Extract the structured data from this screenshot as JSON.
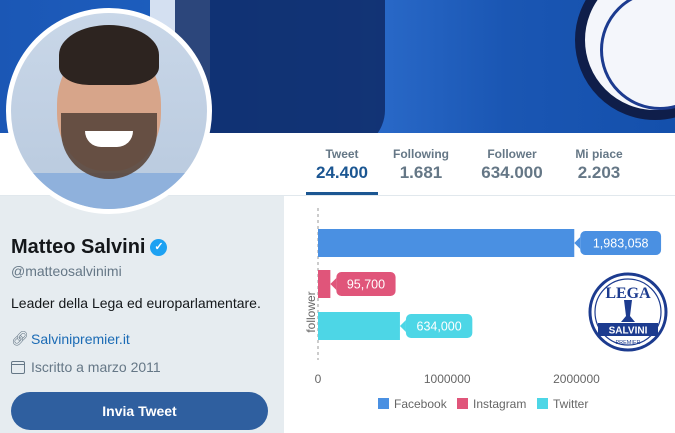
{
  "profile": {
    "name": "Matteo Salvini",
    "handle": "@matteosalvinimi",
    "bio": "Leader della Lega ed europarlamentare.",
    "link": "Salvinipremier.it",
    "joined": "Iscritto a marzo 2011",
    "tweet_button": "Invia Tweet"
  },
  "stats": [
    {
      "label": "Tweet",
      "value": "24.400",
      "active": true
    },
    {
      "label": "Following",
      "value": "1.681",
      "active": false
    },
    {
      "label": "Follower",
      "value": "634.000",
      "active": false
    },
    {
      "label": "Mi piace",
      "value": "2.203",
      "active": false
    }
  ],
  "logo": {
    "top": "LEGA",
    "bottom": "SALVINI",
    "sub": "PREMIER"
  },
  "colors": {
    "accent": "#1b5692",
    "facebook": "#4a90e2",
    "instagram": "#e0557a",
    "twitter": "#4dd6e6"
  },
  "chart_data": {
    "type": "bar",
    "orientation": "horizontal",
    "ylabel": "follower",
    "xlabel": "",
    "xlim": [
      0,
      2600000
    ],
    "xticks": [
      0,
      1000000,
      2000000
    ],
    "xtick_labels": [
      "0",
      "1000000",
      "2000000"
    ],
    "series": [
      {
        "name": "Facebook",
        "value": 1983058,
        "label": "1,983,058",
        "color": "#4a90e2"
      },
      {
        "name": "Instagram",
        "value": 95700,
        "label": "95,700",
        "color": "#e0557a"
      },
      {
        "name": "Twitter",
        "value": 634000,
        "label": "634,000",
        "color": "#4dd6e6"
      }
    ],
    "legend_position": "bottom"
  }
}
